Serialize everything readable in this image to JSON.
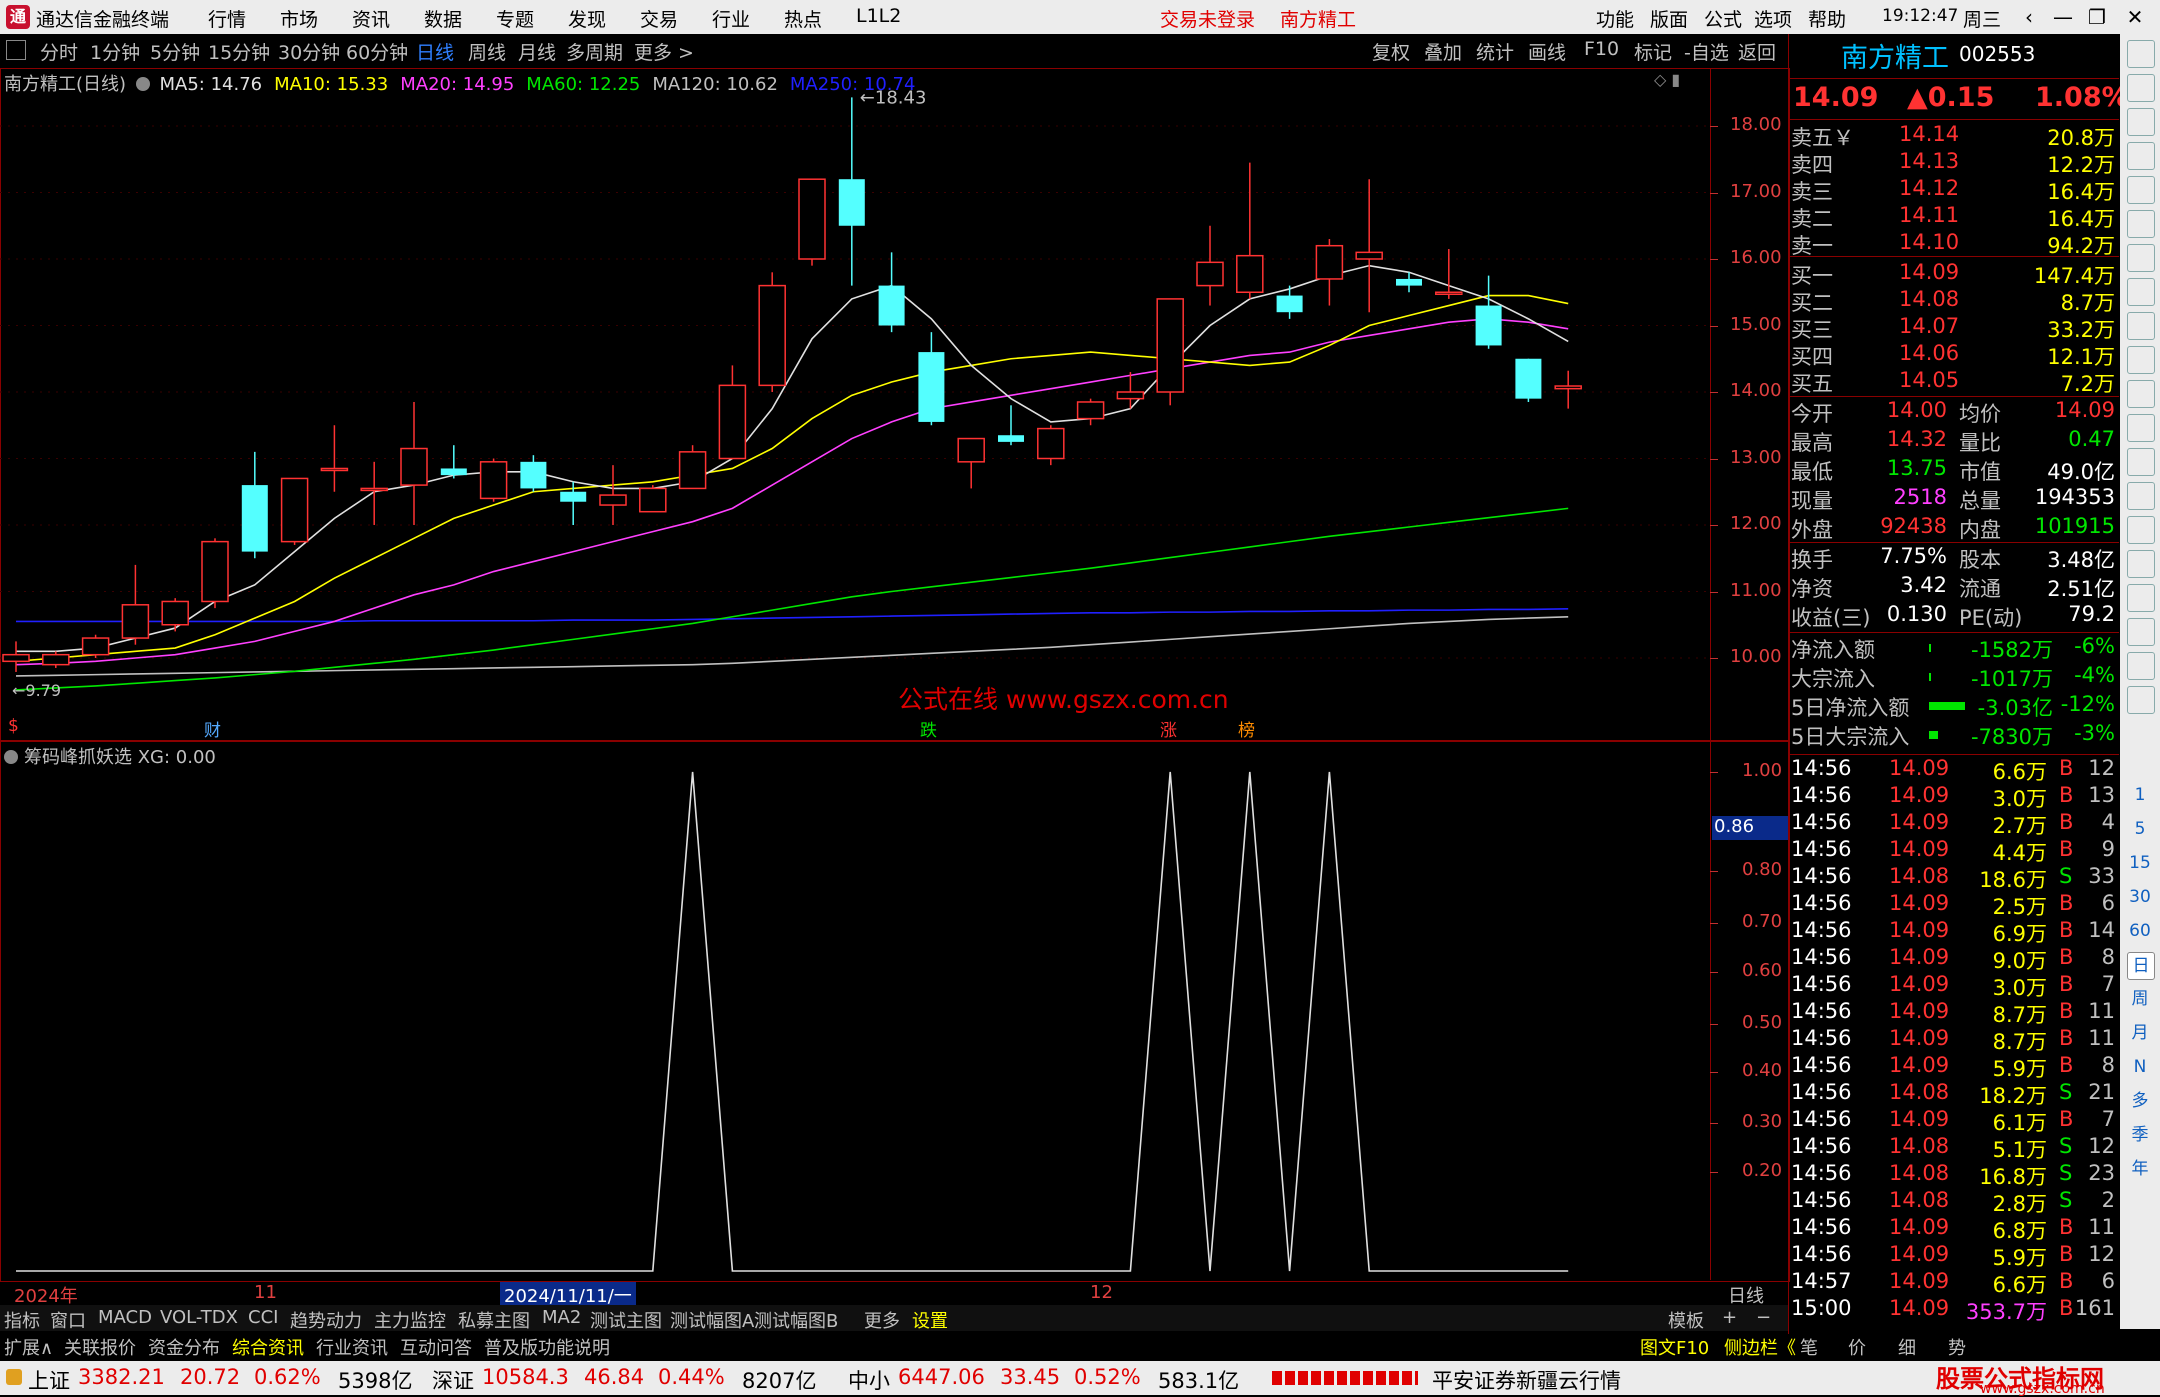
{
  "window": {
    "app_title": "通达信金融终端",
    "menu": [
      "行情",
      "市场",
      "资讯",
      "数据",
      "专题",
      "发现",
      "交易",
      "行业",
      "热点",
      "L1L2"
    ],
    "login_status": "交易未登录",
    "stock_name_title": "南方精工",
    "right_menu": [
      "功能",
      "版面",
      "公式",
      "选项",
      "帮助"
    ],
    "time": "19:12:47",
    "weekday": "周三"
  },
  "periods": [
    "分时",
    "1分钟",
    "5分钟",
    "15分钟",
    "30分钟",
    "60分钟",
    "日线",
    "周线",
    "月线",
    "多周期",
    "更多 >"
  ],
  "active_period": "日线",
  "chart_tools": [
    "复权",
    "叠加",
    "统计",
    "画线",
    "F10",
    "标记",
    "-自选",
    "返回"
  ],
  "main_chart": {
    "header_name": "南方精工(日线)",
    "ma": [
      {
        "label": "MA5: 14.76",
        "color": "#e0e0e0"
      },
      {
        "label": "MA10: 15.33",
        "color": "#ffff00"
      },
      {
        "label": "MA20: 14.95",
        "color": "#ff40ff"
      },
      {
        "label": "MA60: 12.25",
        "color": "#00e600"
      },
      {
        "label": "MA120: 10.62",
        "color": "#c0c0c0"
      },
      {
        "label": "MA250: 10.74",
        "color": "#2020ff"
      }
    ],
    "high_marker": "18.43",
    "low_marker": "9.79",
    "y_ticks": [
      "18.00",
      "17.00",
      "16.00",
      "15.00",
      "14.00",
      "13.00",
      "12.00",
      "11.00",
      "10.00"
    ],
    "watermark": "公式在线  www.gszx.com.cn",
    "event_labels": [
      "$",
      "财",
      "跌",
      "涨",
      "榜"
    ]
  },
  "chart_data": [
    {
      "type": "candlestick",
      "title": "南方精工(日线)",
      "ylim": [
        9.5,
        18.6
      ],
      "candles": [
        {
          "o": 9.95,
          "h": 10.25,
          "l": 9.79,
          "c": 10.05
        },
        {
          "o": 9.9,
          "h": 10.1,
          "l": 9.85,
          "c": 10.05
        },
        {
          "o": 10.05,
          "h": 10.35,
          "l": 10.0,
          "c": 10.3
        },
        {
          "o": 10.3,
          "h": 11.4,
          "l": 10.2,
          "c": 10.8
        },
        {
          "o": 10.5,
          "h": 10.9,
          "l": 10.4,
          "c": 10.85
        },
        {
          "o": 10.85,
          "h": 11.8,
          "l": 10.75,
          "c": 11.75
        },
        {
          "o": 12.6,
          "h": 13.1,
          "l": 11.5,
          "c": 11.6
        },
        {
          "o": 11.75,
          "h": 12.7,
          "l": 11.7,
          "c": 12.7
        },
        {
          "o": 12.85,
          "h": 13.5,
          "l": 12.5,
          "c": 12.85
        },
        {
          "o": 12.55,
          "h": 12.95,
          "l": 12.0,
          "c": 12.55
        },
        {
          "o": 12.6,
          "h": 13.85,
          "l": 12.0,
          "c": 13.15
        },
        {
          "o": 12.85,
          "h": 13.2,
          "l": 12.7,
          "c": 12.75
        },
        {
          "o": 12.4,
          "h": 13.0,
          "l": 12.35,
          "c": 12.95
        },
        {
          "o": 12.95,
          "h": 13.05,
          "l": 12.5,
          "c": 12.55
        },
        {
          "o": 12.5,
          "h": 12.65,
          "l": 12.0,
          "c": 12.35
        },
        {
          "o": 12.3,
          "h": 12.9,
          "l": 12.0,
          "c": 12.45
        },
        {
          "o": 12.2,
          "h": 12.6,
          "l": 12.2,
          "c": 12.55
        },
        {
          "o": 12.55,
          "h": 13.2,
          "l": 12.55,
          "c": 13.1
        },
        {
          "o": 13.0,
          "h": 14.4,
          "l": 13.0,
          "c": 14.1
        },
        {
          "o": 14.1,
          "h": 15.8,
          "l": 14.0,
          "c": 15.6
        },
        {
          "o": 16.0,
          "h": 17.2,
          "l": 15.9,
          "c": 17.2
        },
        {
          "o": 17.2,
          "h": 18.43,
          "l": 15.6,
          "c": 16.5
        },
        {
          "o": 15.6,
          "h": 16.1,
          "l": 14.9,
          "c": 15.0
        },
        {
          "o": 14.6,
          "h": 14.9,
          "l": 13.5,
          "c": 13.55
        },
        {
          "o": 12.95,
          "h": 13.1,
          "l": 12.55,
          "c": 13.3
        },
        {
          "o": 13.35,
          "h": 13.8,
          "l": 13.2,
          "c": 13.25
        },
        {
          "o": 13.0,
          "h": 13.5,
          "l": 12.9,
          "c": 13.45
        },
        {
          "o": 13.6,
          "h": 13.9,
          "l": 13.5,
          "c": 13.85
        },
        {
          "o": 13.9,
          "h": 14.3,
          "l": 13.75,
          "c": 14.0
        },
        {
          "o": 14.0,
          "h": 15.4,
          "l": 13.8,
          "c": 15.4
        },
        {
          "o": 15.6,
          "h": 16.5,
          "l": 15.3,
          "c": 15.95
        },
        {
          "o": 15.5,
          "h": 17.45,
          "l": 15.4,
          "c": 16.05
        },
        {
          "o": 15.45,
          "h": 15.6,
          "l": 15.1,
          "c": 15.2
        },
        {
          "o": 15.7,
          "h": 16.3,
          "l": 15.3,
          "c": 16.2
        },
        {
          "o": 16.0,
          "h": 17.2,
          "l": 15.2,
          "c": 16.1
        },
        {
          "o": 15.7,
          "h": 15.8,
          "l": 15.5,
          "c": 15.6
        },
        {
          "o": 15.5,
          "h": 16.15,
          "l": 15.4,
          "c": 15.5
        },
        {
          "o": 15.3,
          "h": 15.75,
          "l": 14.65,
          "c": 14.7
        },
        {
          "o": 14.5,
          "h": 14.5,
          "l": 13.85,
          "c": 13.9
        },
        {
          "o": 14.05,
          "h": 14.32,
          "l": 13.75,
          "c": 14.09
        }
      ],
      "ma5": [
        10.1,
        10.1,
        10.15,
        10.3,
        10.45,
        10.85,
        11.1,
        11.6,
        12.1,
        12.5,
        12.6,
        12.75,
        12.8,
        12.8,
        12.65,
        12.55,
        12.55,
        12.65,
        13.0,
        13.75,
        14.8,
        15.4,
        15.6,
        15.1,
        14.4,
        13.9,
        13.55,
        13.6,
        13.75,
        14.4,
        15.0,
        15.4,
        15.55,
        15.75,
        15.9,
        15.8,
        15.6,
        15.4,
        15.1,
        14.76
      ],
      "ma10": [
        9.95,
        10.0,
        10.05,
        10.1,
        10.15,
        10.35,
        10.6,
        10.85,
        11.2,
        11.5,
        11.8,
        12.1,
        12.3,
        12.5,
        12.55,
        12.6,
        12.65,
        12.75,
        12.85,
        13.15,
        13.6,
        13.95,
        14.15,
        14.3,
        14.4,
        14.5,
        14.55,
        14.6,
        14.55,
        14.5,
        14.45,
        14.4,
        14.45,
        14.7,
        15.0,
        15.15,
        15.3,
        15.45,
        15.45,
        15.33
      ],
      "ma20": [
        9.9,
        9.92,
        9.95,
        10.0,
        10.05,
        10.15,
        10.25,
        10.4,
        10.55,
        10.75,
        10.95,
        11.1,
        11.3,
        11.45,
        11.6,
        11.75,
        11.9,
        12.05,
        12.25,
        12.6,
        12.95,
        13.3,
        13.55,
        13.75,
        13.85,
        13.95,
        14.05,
        14.15,
        14.25,
        14.35,
        14.45,
        14.55,
        14.6,
        14.75,
        14.85,
        14.95,
        15.05,
        15.1,
        15.05,
        14.95
      ],
      "ma60": [
        9.52,
        9.55,
        9.58,
        9.62,
        9.66,
        9.7,
        9.75,
        9.8,
        9.86,
        9.92,
        9.98,
        10.05,
        10.12,
        10.2,
        10.28,
        10.36,
        10.44,
        10.52,
        10.62,
        10.72,
        10.82,
        10.92,
        11.0,
        11.07,
        11.14,
        11.21,
        11.28,
        11.35,
        11.43,
        11.51,
        11.59,
        11.67,
        11.75,
        11.83,
        11.9,
        11.97,
        12.04,
        12.11,
        12.18,
        12.25
      ],
      "ma120": [
        9.73,
        9.74,
        9.75,
        9.76,
        9.77,
        9.78,
        9.79,
        9.8,
        9.81,
        9.82,
        9.83,
        9.84,
        9.85,
        9.86,
        9.87,
        9.88,
        9.89,
        9.9,
        9.92,
        9.95,
        9.98,
        10.01,
        10.04,
        10.07,
        10.1,
        10.13,
        10.16,
        10.2,
        10.24,
        10.28,
        10.32,
        10.36,
        10.4,
        10.44,
        10.48,
        10.52,
        10.55,
        10.58,
        10.6,
        10.62
      ],
      "ma250": [
        10.55,
        10.55,
        10.55,
        10.55,
        10.55,
        10.55,
        10.55,
        10.55,
        10.55,
        10.56,
        10.56,
        10.56,
        10.56,
        10.56,
        10.57,
        10.57,
        10.57,
        10.58,
        10.59,
        10.6,
        10.61,
        10.62,
        10.63,
        10.64,
        10.65,
        10.66,
        10.67,
        10.68,
        10.68,
        10.69,
        10.69,
        10.7,
        10.7,
        10.71,
        10.71,
        10.72,
        10.72,
        10.73,
        10.73,
        10.74
      ]
    },
    {
      "type": "line",
      "title": "筹码峰抓妖选",
      "ylim": [
        0,
        1.05
      ],
      "values": [
        0,
        0,
        0,
        0,
        0,
        0,
        0,
        0,
        0,
        0,
        0,
        0,
        0,
        0,
        0,
        0,
        0,
        1,
        0,
        0,
        0,
        0,
        0,
        0,
        0,
        0,
        0,
        0,
        0,
        1,
        0,
        1,
        0,
        1,
        0,
        0,
        0,
        0,
        0,
        0
      ]
    }
  ],
  "sub_chart": {
    "header": "筹码峰抓妖选  XG: 0.00",
    "y_ticks": [
      "1.00",
      "0.80",
      "0.70",
      "0.60",
      "0.50",
      "0.40",
      "0.30",
      "0.20"
    ],
    "cursor_value": "0.86"
  },
  "date_axis": {
    "labels": [
      "2024年",
      "11",
      "2024/11/11/一",
      "12"
    ],
    "right_label": "日线"
  },
  "bottom_tabs": [
    "指标",
    "窗口",
    "MACD",
    "VOL-TDX",
    "CCI",
    "趋势动力",
    "主力监控",
    "私募主图",
    "MA2",
    "测试主图",
    "测试幅图A",
    "测试幅图B",
    "更多",
    "设置"
  ],
  "bottom_right_tabs": [
    "模板",
    "+",
    "−"
  ],
  "status_tabs": [
    "扩展∧",
    "关联报价",
    "资金分布",
    "综合资讯",
    "行业资讯",
    "互动问答",
    "普及版功能说明"
  ],
  "status_right": [
    "图文F10",
    "侧边栏《",
    "笔",
    "价",
    "细",
    "势"
  ],
  "quote": {
    "name": "南方精工",
    "code": "002553",
    "price": "14.09",
    "change": "▲0.15",
    "pct": "1.08%",
    "asks": [
      {
        "label": "卖五￥",
        "price": "14.14",
        "vol": "20.8万"
      },
      {
        "label": "卖四",
        "price": "14.13",
        "vol": "12.2万"
      },
      {
        "label": "卖三",
        "price": "14.12",
        "vol": "16.4万"
      },
      {
        "label": "卖二",
        "price": "14.11",
        "vol": "16.4万"
      },
      {
        "label": "卖一",
        "price": "14.10",
        "vol": "94.2万"
      }
    ],
    "bids": [
      {
        "label": "买一",
        "price": "14.09",
        "vol": "147.4万"
      },
      {
        "label": "买二",
        "price": "14.08",
        "vol": "8.7万"
      },
      {
        "label": "买三",
        "price": "14.07",
        "vol": "33.2万"
      },
      {
        "label": "买四",
        "price": "14.06",
        "vol": "12.1万"
      },
      {
        "label": "买五",
        "price": "14.05",
        "vol": "7.2万"
      }
    ],
    "stats": [
      {
        "l1": "今开",
        "v1": "14.00",
        "c1": "red",
        "l2": "均价",
        "v2": "14.09",
        "c2": "red"
      },
      {
        "l1": "最高",
        "v1": "14.32",
        "c1": "red",
        "l2": "量比",
        "v2": "0.47",
        "c2": "green"
      },
      {
        "l1": "最低",
        "v1": "13.75",
        "c1": "green",
        "l2": "市值",
        "v2": "49.0亿",
        "c2": "white"
      },
      {
        "l1": "现量",
        "v1": "2518",
        "c1": "magenta",
        "l2": "总量",
        "v2": "194353",
        "c2": "white"
      },
      {
        "l1": "外盘",
        "v1": "92438",
        "c1": "red",
        "l2": "内盘",
        "v2": "101915",
        "c2": "green"
      }
    ],
    "fundamentals": [
      {
        "l1": "换手",
        "v1": "7.75%",
        "l2": "股本",
        "v2": "3.48亿"
      },
      {
        "l1": "净资",
        "v1": "3.42",
        "l2": "流通",
        "v2": "2.51亿"
      },
      {
        "l1": "收益(三)",
        "v1": "0.130",
        "l2": "PE(动)",
        "v2": "79.2"
      }
    ],
    "flows": [
      {
        "label": "净流入额",
        "value": "-1582万",
        "pct": "-6%",
        "bar": 0.01
      },
      {
        "label": "大宗流入",
        "value": "-1017万",
        "pct": "-4%",
        "bar": 0.01
      },
      {
        "label": "5日净流入额",
        "value": "-3.03亿",
        "pct": "-12%",
        "bar": 0.6
      },
      {
        "label": "5日大宗流入",
        "value": "-7830万",
        "pct": "-3%",
        "bar": 0.15
      }
    ],
    "ticks": [
      {
        "t": "14:56",
        "p": "14.09",
        "v": "6.6万",
        "s": "B",
        "n": "12"
      },
      {
        "t": "14:56",
        "p": "14.09",
        "v": "3.0万",
        "s": "B",
        "n": "13"
      },
      {
        "t": "14:56",
        "p": "14.09",
        "v": "2.7万",
        "s": "B",
        "n": "4"
      },
      {
        "t": "14:56",
        "p": "14.09",
        "v": "4.4万",
        "s": "B",
        "n": "9"
      },
      {
        "t": "14:56",
        "p": "14.08",
        "v": "18.6万",
        "s": "S",
        "n": "33"
      },
      {
        "t": "14:56",
        "p": "14.09",
        "v": "2.5万",
        "s": "B",
        "n": "6"
      },
      {
        "t": "14:56",
        "p": "14.09",
        "v": "6.9万",
        "s": "B",
        "n": "14"
      },
      {
        "t": "14:56",
        "p": "14.09",
        "v": "9.0万",
        "s": "B",
        "n": "8"
      },
      {
        "t": "14:56",
        "p": "14.09",
        "v": "3.0万",
        "s": "B",
        "n": "7"
      },
      {
        "t": "14:56",
        "p": "14.09",
        "v": "8.7万",
        "s": "B",
        "n": "11"
      },
      {
        "t": "14:56",
        "p": "14.09",
        "v": "8.7万",
        "s": "B",
        "n": "11"
      },
      {
        "t": "14:56",
        "p": "14.09",
        "v": "5.9万",
        "s": "B",
        "n": "8"
      },
      {
        "t": "14:56",
        "p": "14.08",
        "v": "18.2万",
        "s": "S",
        "n": "21"
      },
      {
        "t": "14:56",
        "p": "14.09",
        "v": "6.1万",
        "s": "B",
        "n": "7"
      },
      {
        "t": "14:56",
        "p": "14.08",
        "v": "5.1万",
        "s": "S",
        "n": "12"
      },
      {
        "t": "14:56",
        "p": "14.08",
        "v": "16.8万",
        "s": "S",
        "n": "23"
      },
      {
        "t": "14:56",
        "p": "14.08",
        "v": "2.8万",
        "s": "S",
        "n": "2"
      },
      {
        "t": "14:56",
        "p": "14.09",
        "v": "6.8万",
        "s": "B",
        "n": "11"
      },
      {
        "t": "14:56",
        "p": "14.09",
        "v": "5.9万",
        "s": "B",
        "n": "12"
      },
      {
        "t": "14:57",
        "p": "14.09",
        "v": "6.6万",
        "s": "B",
        "n": "6"
      },
      {
        "t": "15:00",
        "p": "14.09",
        "v": "353.7万",
        "s": "B",
        "n": "161"
      }
    ]
  },
  "sidebar_icons": [
    "exit-icon",
    "up-arrow-icon",
    "down-arrow-icon",
    "info-icon",
    "table-icon",
    "chart-icon",
    "bar-chart-icon",
    "list-icon",
    "fin-icon",
    "doc-icon",
    "money-icon",
    "f2-icon",
    "clock-icon",
    "settings-icon",
    "rsi-icon",
    "stock-icon",
    "move-icon",
    "pen-icon",
    "f5-icon",
    "grid-icon"
  ],
  "sidebar_periods": [
    "1",
    "5",
    "15",
    "30",
    "60",
    "日",
    "周",
    "月",
    "N",
    "多",
    "季",
    "年"
  ],
  "ticker": {
    "items": [
      {
        "name": "上证",
        "val": "3382.21",
        "chg": "20.72",
        "pct": "0.62%",
        "amt": "5398亿"
      },
      {
        "name": "深证",
        "val": "10584.3",
        "chg": "46.84",
        "pct": "0.44%",
        "amt": "8207亿"
      },
      {
        "name": "中小",
        "val": "6447.06",
        "chg": "33.45",
        "pct": "0.52%",
        "amt": "583.1亿"
      }
    ],
    "broker": "平安证券新疆云行情",
    "brand": "股票公式指标网",
    "brand_url": "www.gszx.com.cn"
  }
}
